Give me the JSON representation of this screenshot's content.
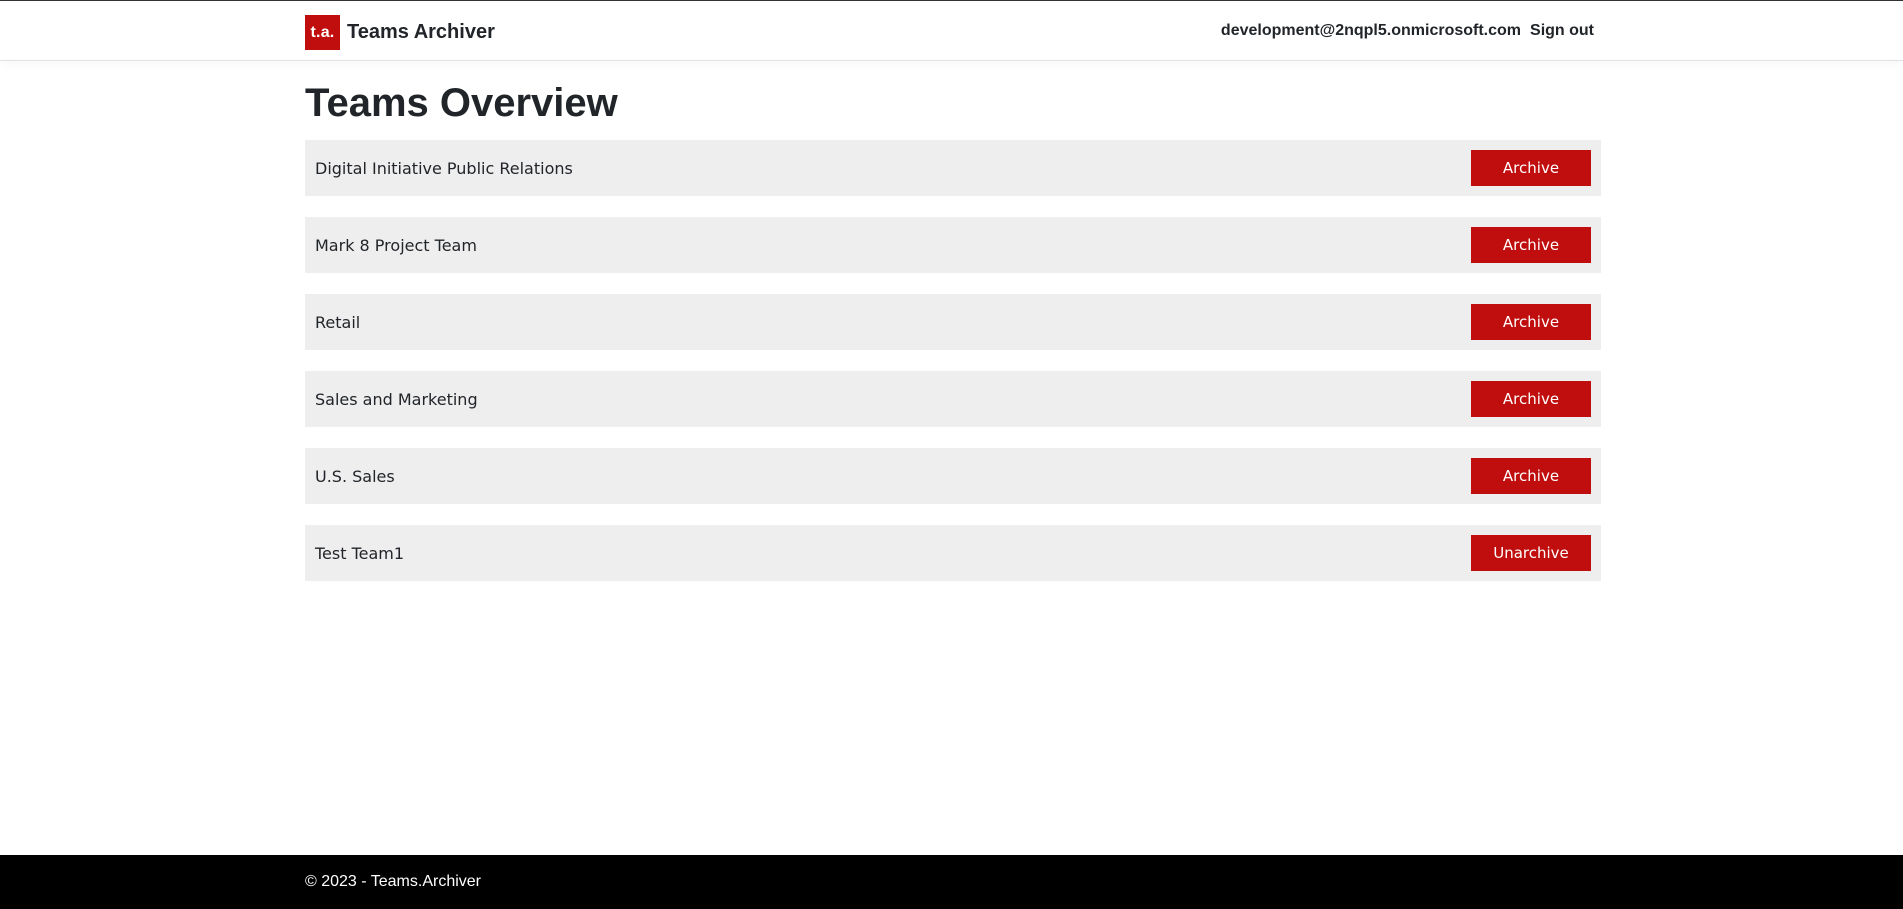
{
  "header": {
    "logo_text": "t.a.",
    "app_name": "Teams Archiver",
    "user_email": "development@2nqpl5.onmicrosoft.com",
    "sign_out_label": "Sign out"
  },
  "main": {
    "title": "Teams Overview",
    "teams": [
      {
        "name": "Digital Initiative Public Relations",
        "action": "Archive"
      },
      {
        "name": "Mark 8 Project Team",
        "action": "Archive"
      },
      {
        "name": "Retail",
        "action": "Archive"
      },
      {
        "name": "Sales and Marketing",
        "action": "Archive"
      },
      {
        "name": "U.S. Sales",
        "action": "Archive"
      },
      {
        "name": "Test Team1",
        "action": "Unarchive"
      }
    ]
  },
  "footer": {
    "text": "© 2023 - Teams.Archiver"
  },
  "colors": {
    "accent": "#c00d0d",
    "row_background": "#eeeeee",
    "footer_background": "#000000"
  }
}
